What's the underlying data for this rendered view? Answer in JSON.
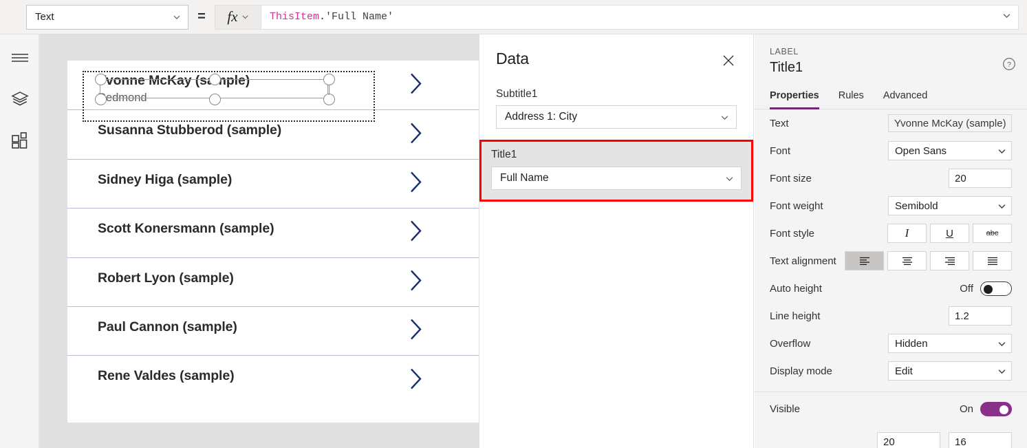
{
  "formula_bar": {
    "property_selector": "Text",
    "equals": "=",
    "fx_label": "fx",
    "formula": {
      "identifier": "ThisItem",
      "dot": ".",
      "field": "'Full Name'"
    }
  },
  "left_rail": {
    "items": [
      {
        "icon": "hamburger-menu-icon",
        "name": "menu"
      },
      {
        "icon": "layers-icon",
        "name": "tree-view"
      },
      {
        "icon": "insert-grid-icon",
        "name": "insert"
      }
    ]
  },
  "canvas": {
    "gallery": {
      "items": [
        {
          "title": "Yvonne McKay (sample)",
          "subtitle": "Redmond",
          "selected": true
        },
        {
          "title": "Susanna Stubberod (sample)",
          "subtitle": "",
          "selected": false
        },
        {
          "title": "Sidney Higa (sample)",
          "subtitle": "",
          "selected": false
        },
        {
          "title": "Scott Konersmann (sample)",
          "subtitle": "",
          "selected": false
        },
        {
          "title": "Robert Lyon (sample)",
          "subtitle": "",
          "selected": false
        },
        {
          "title": "Paul Cannon (sample)",
          "subtitle": "",
          "selected": false
        },
        {
          "title": "Rene Valdes (sample)",
          "subtitle": "",
          "selected": false
        }
      ],
      "chevron_icon": "chevron-right-icon",
      "chevron_color": "#1a2e6e",
      "divider_color": "#b8bdd4"
    }
  },
  "data_panel": {
    "title": "Data",
    "close_icon": "close-icon",
    "fields": [
      {
        "label": "Subtitle1",
        "value": "Address 1: City",
        "highlighted": false
      },
      {
        "label": "Title1",
        "value": "Full Name",
        "highlighted": true
      }
    ],
    "highlight_color": "#ff0000"
  },
  "properties_panel": {
    "kind": "LABEL",
    "name": "Title1",
    "help_icon": "help-circle-icon",
    "tabs": [
      {
        "label": "Properties",
        "active": true
      },
      {
        "label": "Rules",
        "active": false
      },
      {
        "label": "Advanced",
        "active": false
      }
    ],
    "accent_color": "#742774",
    "rows": [
      {
        "label": "Text",
        "type": "text",
        "value": "Yvonne McKay (sample)"
      },
      {
        "label": "Font",
        "type": "dropdown",
        "value": "Open Sans"
      },
      {
        "label": "Font size",
        "type": "number",
        "value": "20"
      },
      {
        "label": "Font weight",
        "type": "dropdown",
        "value": "Semibold"
      },
      {
        "label": "Font style",
        "type": "style-group",
        "buttons": [
          {
            "glyph": "I",
            "icon": "italic-icon",
            "active": false
          },
          {
            "glyph": "U",
            "icon": "underline-icon",
            "active": false
          },
          {
            "glyph": "abc",
            "icon": "strikethrough-icon",
            "active": false
          }
        ]
      },
      {
        "label": "Text alignment",
        "type": "align-group",
        "buttons": [
          {
            "icon": "align-left-icon",
            "active": true
          },
          {
            "icon": "align-center-icon",
            "active": false
          },
          {
            "icon": "align-right-icon",
            "active": false
          },
          {
            "icon": "align-justify-icon",
            "active": false
          }
        ]
      },
      {
        "label": "Auto height",
        "type": "toggle",
        "state": "Off",
        "on": false
      },
      {
        "label": "Line height",
        "type": "number",
        "value": "1.2"
      },
      {
        "label": "Overflow",
        "type": "dropdown",
        "value": "Hidden"
      },
      {
        "label": "Display mode",
        "type": "dropdown",
        "value": "Edit"
      }
    ],
    "visible_row": {
      "label": "Visible",
      "state": "On",
      "on": true
    },
    "bottom_partial_values": [
      "20",
      "16"
    ]
  }
}
